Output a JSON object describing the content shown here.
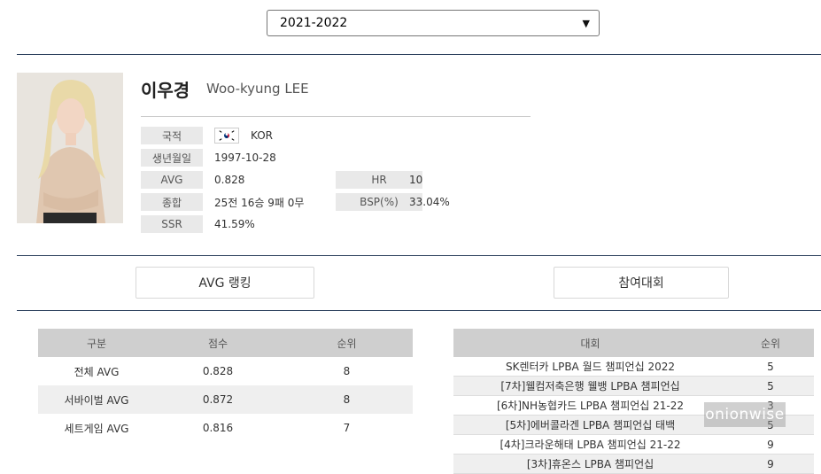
{
  "season_select": {
    "value": "2021-2022"
  },
  "player": {
    "name_ko": "이우경",
    "name_en": "Woo-kyung LEE"
  },
  "info": {
    "nationality": {
      "label": "국적",
      "value": "KOR"
    },
    "birthdate": {
      "label": "생년월일",
      "value": "1997-10-28"
    },
    "avg": {
      "label": "AVG",
      "value": "0.828"
    },
    "hr": {
      "label": "HR",
      "value": "10"
    },
    "record": {
      "label": "종합",
      "value": "25전 16승 9패 0무"
    },
    "bsp": {
      "label": "BSP(%)",
      "value": "33.04%"
    },
    "ssr": {
      "label": "SSR",
      "value": "41.59%"
    }
  },
  "tabs": {
    "avg_ranking": "AVG 랭킹",
    "competitions": "참여대회"
  },
  "ranking_table": {
    "headers": [
      "구분",
      "점수",
      "순위"
    ],
    "rows": [
      [
        "전체 AVG",
        "0.828",
        "8"
      ],
      [
        "서바이벌 AVG",
        "0.872",
        "8"
      ],
      [
        "세트게임 AVG",
        "0.816",
        "7"
      ]
    ]
  },
  "competition_table": {
    "headers": [
      "대회",
      "순위"
    ],
    "rows": [
      [
        "SK렌터카 LPBA 월드 챔피언십 2022",
        "5"
      ],
      [
        "[7차]웰컴저축은행 웰뱅 LPBA 챔피언십",
        "5"
      ],
      [
        "[6차]NH농협카드 LPBA 챔피언십 21-22",
        "3"
      ],
      [
        "[5차]에버콜라겐 LPBA 챔피언십 태백",
        "5"
      ],
      [
        "[4차]크라운해태 LPBA 챔피언십 21-22",
        "9"
      ],
      [
        "[3차]휴온스 LPBA 챔피언십",
        "9"
      ]
    ]
  },
  "watermark": "onionwise",
  "colors": {
    "rule": "#2b3f5c",
    "label_bg": "#e9e9e9",
    "header_bg": "#cfcfcf"
  }
}
